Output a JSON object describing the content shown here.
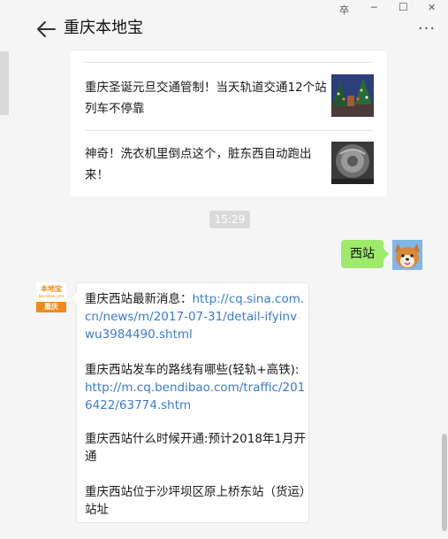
{
  "window": {
    "title": "重庆本地宝",
    "controls": {
      "pin_label": "卒",
      "minimize_label": "─",
      "maximize_label": "☐",
      "close_label": "✕"
    },
    "more_label": "···"
  },
  "articles": [
    {
      "title": "重庆圣诞元旦交通管制！当天轨道交通12个站列车不停靠",
      "thumb_icon": "christmas-tree-thumbnail"
    },
    {
      "title": "神奇！洗衣机里倒点这个，脏东西自动跑出来！",
      "thumb_icon": "washing-machine-drum-thumbnail"
    }
  ],
  "time_divider": "15:29",
  "outgoing_message": {
    "text": "西站",
    "avatar_icon": "shiba-dog-avatar"
  },
  "incoming_message": {
    "avatar": {
      "logo_text": "本地宝",
      "sub_text": "bendibao.com",
      "city": "重庆"
    },
    "blocks": [
      {
        "text": "重庆西站最新消息：",
        "link": "http://cq.sina.com.cn/news/m/2017-07-31/detail-ifyinvwu3984490.shtml"
      },
      {
        "text": "重庆西站发车的路线有哪些(轻轨+高铁):",
        "link": "http://m.cq.bendibao.com/traffic/2016422/63774.shtm"
      },
      {
        "text": "重庆西站什么时候开通:预计2018年1月开通",
        "link": ""
      },
      {
        "text": "重庆西站位于沙坪坝区原上桥东站（货运）站址",
        "link": ""
      }
    ]
  },
  "colors": {
    "background": "#f5f5f5",
    "outgoing_bubble": "#9eea6a",
    "link": "#3a7bd5",
    "brand_orange": "#f08a1c"
  }
}
